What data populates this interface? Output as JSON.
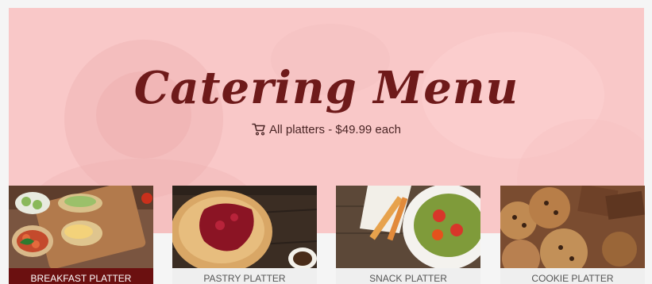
{
  "hero": {
    "title": "Catering Menu",
    "subtitle": "All platters - $49.99 each",
    "cart_icon": "shopping-cart-icon"
  },
  "platters": [
    {
      "name": "BREAKFAST PLATTER",
      "active": true
    },
    {
      "name": "PASTRY PLATTER",
      "active": false
    },
    {
      "name": "SNACK PLATTER",
      "active": false
    },
    {
      "name": "COOKIE PLATTER",
      "active": false
    }
  ],
  "colors": {
    "hero_background": "#f9c8c8",
    "title": "#6e1a1a",
    "active_caption": "#6b1010",
    "caption": "#efefef"
  }
}
